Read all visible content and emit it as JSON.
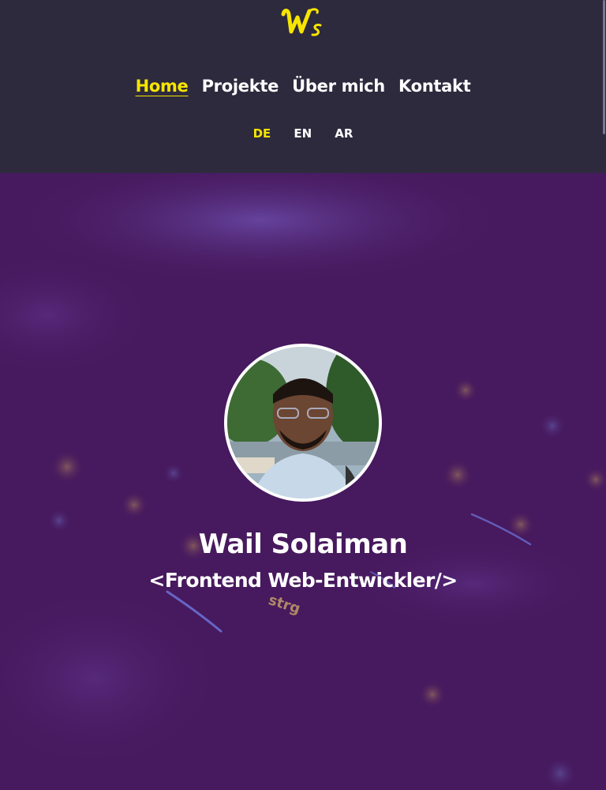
{
  "logo": {
    "text": "Ws"
  },
  "nav": {
    "items": [
      {
        "label": "Home",
        "active": true
      },
      {
        "label": "Projekte",
        "active": false
      },
      {
        "label": "Über mich",
        "active": false
      },
      {
        "label": "Kontakt",
        "active": false
      }
    ]
  },
  "languages": {
    "items": [
      {
        "label": "DE",
        "active": true
      },
      {
        "label": "EN",
        "active": false
      },
      {
        "label": "AR",
        "active": false
      }
    ]
  },
  "hero": {
    "name": "Wail Solaiman",
    "role": "<Frontend Web-Entwickler/>"
  },
  "colors": {
    "header_bg": "#2d2a3e",
    "hero_bg": "#47195e",
    "accent": "#f6e500",
    "text": "#ffffff"
  },
  "icons": {
    "logo": "ws-script-logo"
  }
}
